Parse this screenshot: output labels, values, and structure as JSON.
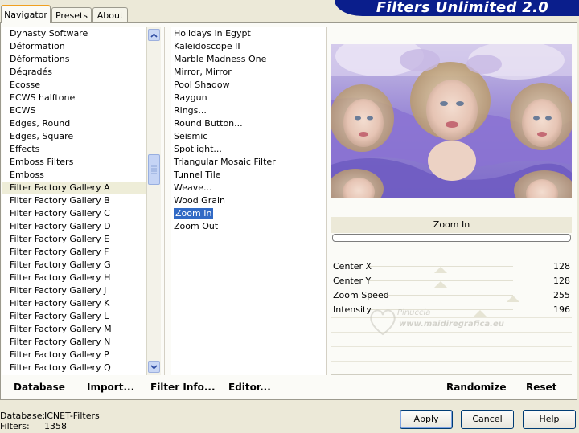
{
  "window": {
    "title": "Filters Unlimited 2.0"
  },
  "tabs": [
    {
      "label": "Navigator",
      "active": true
    },
    {
      "label": "Presets",
      "active": false
    },
    {
      "label": "About",
      "active": false
    }
  ],
  "categories": [
    "Dynasty Software",
    "Déformation",
    "Déformations",
    "Dégradés",
    "Ecosse",
    "ECWS halftone",
    "ECWS",
    "Edges, Round",
    "Edges, Square",
    "Effects",
    "Emboss Filters",
    "Emboss",
    "Filter Factory Gallery A",
    "Filter Factory Gallery B",
    "Filter Factory Gallery C",
    "Filter Factory Gallery D",
    "Filter Factory Gallery E",
    "Filter Factory Gallery F",
    "Filter Factory Gallery G",
    "Filter Factory Gallery H",
    "Filter Factory Gallery J",
    "Filter Factory Gallery K",
    "Filter Factory Gallery L",
    "Filter Factory Gallery M",
    "Filter Factory Gallery N",
    "Filter Factory Gallery P",
    "Filter Factory Gallery Q"
  ],
  "selected_category": "Filter Factory Gallery A",
  "filters": [
    "Holidays in Egypt",
    "Kaleidoscope II",
    "Marble Madness One",
    "Mirror, Mirror",
    "Pool Shadow",
    "Raygun",
    "Rings...",
    "Round Button...",
    "Seismic",
    "Spotlight...",
    "Triangular Mosaic Filter",
    "Tunnel Tile",
    "Weave...",
    "Wood Grain",
    "Zoom In",
    "Zoom Out"
  ],
  "selected_filter": "Zoom In",
  "preview": {
    "filter_name": "Zoom In",
    "progress": 0
  },
  "watermark": {
    "name": "Pinuccia",
    "site": "www.maidiregrafica.eu"
  },
  "params": [
    {
      "label": "Center X",
      "value": "128",
      "level": 0.5
    },
    {
      "label": "Center Y",
      "value": "128",
      "level": 0.5
    },
    {
      "label": "Zoom Speed",
      "value": "255",
      "level": 1.0
    },
    {
      "label": "Intensity",
      "value": "196",
      "level": 0.77
    }
  ],
  "toolbar": {
    "database": "Database",
    "import": "Import...",
    "filter_info": "Filter Info...",
    "editor": "Editor...",
    "randomize": "Randomize",
    "reset": "Reset"
  },
  "status": {
    "database_label": "Database:",
    "database_value": "ICNET-Filters",
    "filters_label": "Filters:",
    "filters_value": "1358"
  },
  "buttons": {
    "apply": "Apply",
    "cancel": "Cancel",
    "help": "Help"
  },
  "colors": {
    "banner": "#0a1e8c",
    "selection": "#316ac5",
    "accent_tab": "#f0a020"
  }
}
